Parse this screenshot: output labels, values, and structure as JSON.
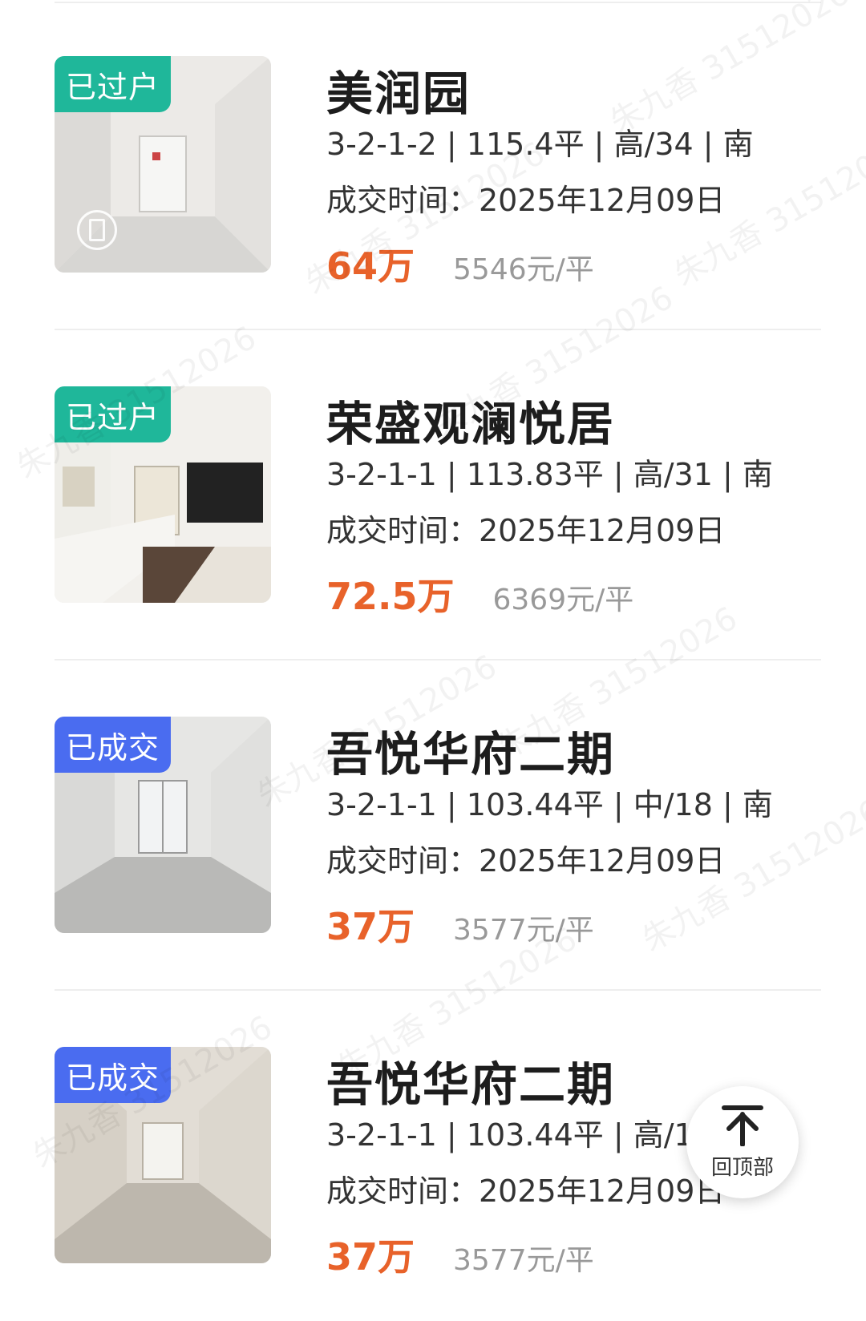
{
  "watermark_text": "朱九香 31512026",
  "colors": {
    "price": "#e8622a",
    "badge_transferred": "#1fb79a",
    "badge_sold": "#4a6cf0"
  },
  "listings": [
    {
      "badge": "已过户",
      "badge_color": "#1fb79a",
      "photo_icon": "vr-view-icon",
      "title": "美润园",
      "specs": "3-2-1-2 | 115.4平 | 高/34 | 南",
      "deal_time": "成交时间：2025年12月09日",
      "price": "64万",
      "unit_price": "5546元/平"
    },
    {
      "badge": "已过户",
      "badge_color": "#1fb79a",
      "title": "荣盛观澜悦居",
      "specs": "3-2-1-1 | 113.83平 | 高/31 | 南",
      "deal_time": "成交时间：2025年12月09日",
      "price": "72.5万",
      "unit_price": "6369元/平"
    },
    {
      "badge": "已成交",
      "badge_color": "#4a6cf0",
      "title": "吾悦华府二期",
      "specs": "3-2-1-1 | 103.44平 | 中/18 | 南",
      "deal_time": "成交时间：2025年12月09日",
      "price": "37万",
      "unit_price": "3577元/平"
    },
    {
      "badge": "已成交",
      "badge_color": "#4a6cf0",
      "title": "吾悦华府二期",
      "specs": "3-2-1-1 | 103.44平 | 高/18",
      "deal_time": "成交时间：2025年12月09日",
      "price": "37万",
      "unit_price": "3577元/平"
    }
  ],
  "back_to_top": {
    "icon": "arrow-up-icon",
    "label": "回顶部"
  }
}
